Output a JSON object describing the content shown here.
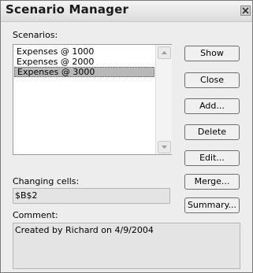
{
  "window": {
    "title": "Scenario Manager"
  },
  "scenarios": {
    "label": "Scenarios:",
    "items": [
      {
        "label": "Expenses @ 1000",
        "selected": false
      },
      {
        "label": "Expenses @ 2000",
        "selected": false
      },
      {
        "label": "Expenses @ 3000",
        "selected": true
      }
    ]
  },
  "buttons": {
    "show": "Show",
    "close": "Close",
    "add": "Add...",
    "delete": "Delete",
    "edit": "Edit...",
    "merge": "Merge...",
    "summary": "Summary..."
  },
  "changing_cells": {
    "label": "Changing cells:",
    "value": "$B$2"
  },
  "comment": {
    "label": "Comment:",
    "value": "Created by Richard on 4/9/2004"
  },
  "icons": {
    "close": "close-icon",
    "scroll_up": "scroll-up-arrow-icon",
    "scroll_down": "scroll-down-arrow-icon"
  }
}
